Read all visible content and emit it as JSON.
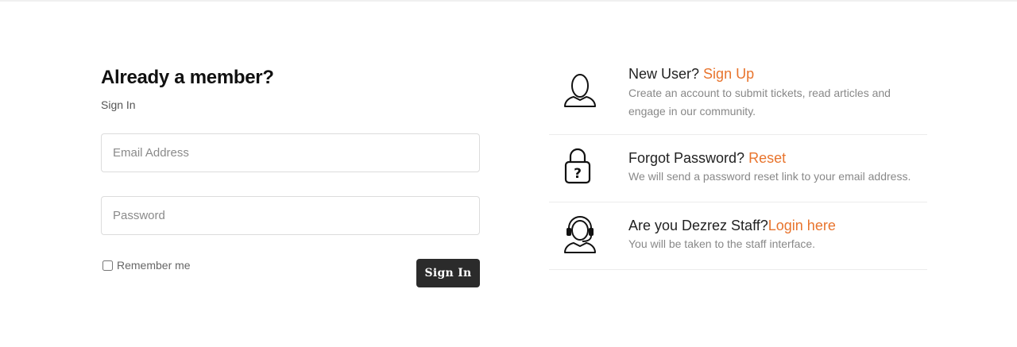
{
  "signin": {
    "heading": "Already a member?",
    "subtitle": "Sign In",
    "email_placeholder": "Email Address",
    "password_placeholder": "Password",
    "remember_label": "Remember me",
    "remember_checked": false,
    "submit_label": "Sign In"
  },
  "info": {
    "accent_color": "#e8742d",
    "rows": [
      {
        "icon": "user-icon",
        "title": "New User?",
        "link": "Sign Up",
        "description": "Create an account to submit tickets, read articles and engage in our community."
      },
      {
        "icon": "lock-question-icon",
        "title": "Forgot Password?",
        "link": "Reset",
        "description": "We will send a password reset link to your email address."
      },
      {
        "icon": "headset-agent-icon",
        "title": "Are you Dezrez Staff?",
        "link": "Login here",
        "description": "You will be taken to the staff interface."
      }
    ]
  }
}
